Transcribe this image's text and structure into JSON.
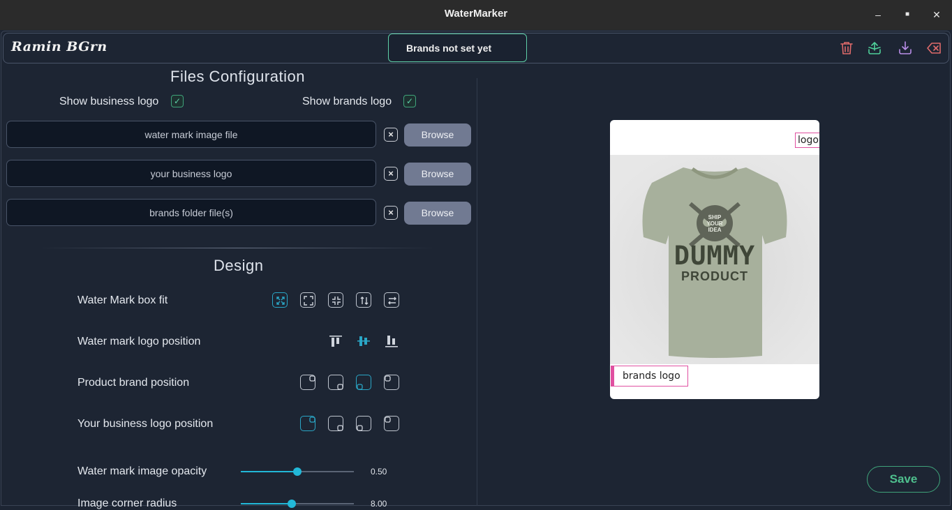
{
  "window": {
    "title": "WaterMarker"
  },
  "header": {
    "brand": "Ramin BGrn",
    "toast": "Brands not set yet",
    "icons": [
      "trash-icon",
      "upload-icon",
      "download-icon",
      "close-icon"
    ]
  },
  "files": {
    "title": "Files Configuration",
    "show_business_logo": "Show business logo",
    "show_brands_logo": "Show brands logo",
    "inputs": [
      {
        "placeholder": "water mark image file",
        "browse": "Browse"
      },
      {
        "placeholder": "your business logo",
        "browse": "Browse"
      },
      {
        "placeholder": "brands folder file(s)",
        "browse": "Browse"
      }
    ]
  },
  "design": {
    "title": "Design",
    "box_fit": "Water Mark box fit",
    "logo_position": "Water mark logo position",
    "brand_position": "Product brand position",
    "business_position": "Your business logo position",
    "opacity_label": "Water mark image opacity",
    "opacity_value": "0.50",
    "opacity": 0.5,
    "radius_label": "Image corner radius",
    "radius_value": "8.00",
    "radius": 0.45
  },
  "preview": {
    "logo": "logo",
    "brands_logo": "brands logo",
    "shirt_top": "SHIP YOUR IDEA",
    "shirt_main": "DUMMY",
    "shirt_sub": "PRODUCT"
  },
  "save": "Save",
  "colors": {
    "accent": "#22b8d8",
    "success": "#4fc08e",
    "tag": "#e04fa0"
  }
}
